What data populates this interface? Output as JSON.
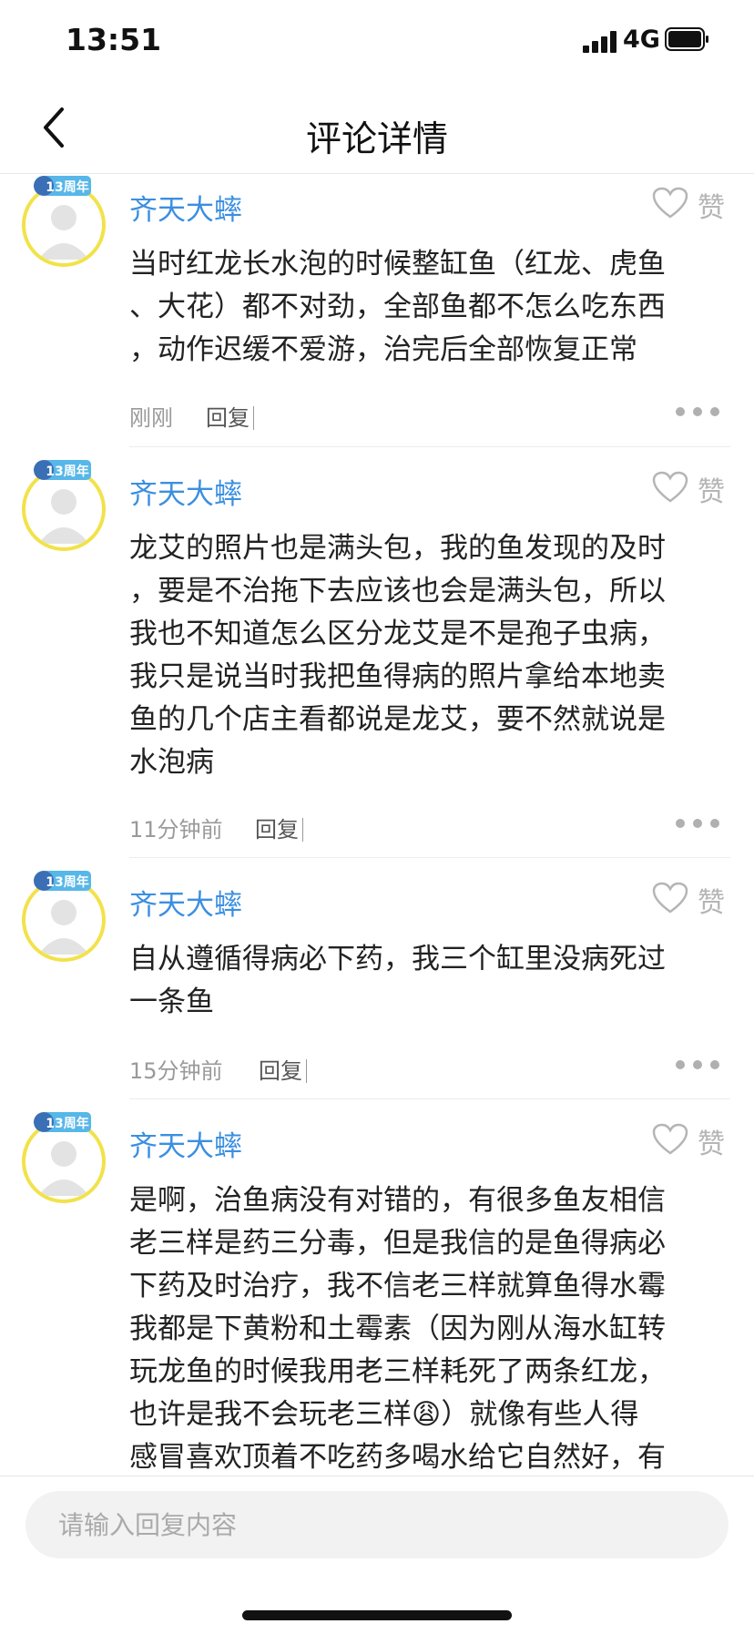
{
  "status": {
    "time": "13:51",
    "network": "4G"
  },
  "header": {
    "title": "评论详情"
  },
  "comments": [
    {
      "badge": "13周年",
      "user": "齐天大蟀",
      "like_label": "赞",
      "lines": [
        "当时红龙长水泡的时候整缸鱼（红龙、虎鱼",
        "、大花）都不对劲，全部鱼都不怎么吃东西",
        "，动作迟缓不爱游，治完后全部恢复正常"
      ],
      "time": "刚刚",
      "reply": "回复"
    },
    {
      "badge": "13周年",
      "user": "齐天大蟀",
      "like_label": "赞",
      "lines": [
        "龙艾的照片也是满头包，我的鱼发现的及时",
        "，要是不治拖下去应该也会是满头包，所以",
        "我也不知道怎么区分龙艾是不是孢子虫病，",
        "我只是说当时我把鱼得病的照片拿给本地卖",
        "鱼的几个店主看都说是龙艾，要不然就说是",
        "水泡病"
      ],
      "time": "11分钟前",
      "reply": "回复"
    },
    {
      "badge": "13周年",
      "user": "齐天大蟀",
      "like_label": "赞",
      "lines": [
        "自从遵循得病必下药，我三个缸里没病死过",
        "一条鱼"
      ],
      "time": "15分钟前",
      "reply": "回复"
    },
    {
      "badge": "13周年",
      "user": "齐天大蟀",
      "like_label": "赞",
      "lines": [
        "是啊，治鱼病没有对错的，有很多鱼友相信",
        "老三样是药三分毒，但是我信的是鱼得病必",
        "下药及时治疗，我不信老三样就算鱼得水霉",
        "我都是下黄粉和土霉素（因为刚从海水缸转",
        "玩龙鱼的时候我用老三样耗死了两条红龙，",
        "也许是我不会玩老三样😩）就像有些人得",
        "感冒喜欢顶着不吃药多喝水给它自然好，有"
      ],
      "time": "",
      "reply": ""
    }
  ],
  "reply_input": {
    "placeholder": "请输入回复内容"
  },
  "colors": {
    "username": "#3b8fe0",
    "avatar_ring": "#f2e24a",
    "badge": "#57b7e8"
  }
}
